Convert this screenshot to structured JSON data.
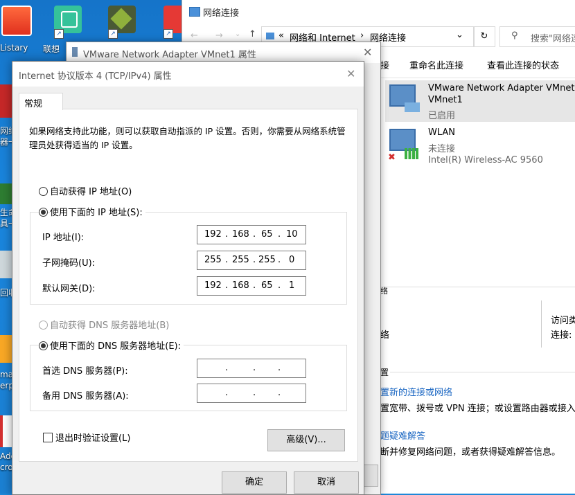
{
  "desktop": {
    "icons": [
      {
        "label": "Listary",
        "name": "listary"
      },
      {
        "label": "联想",
        "name": "lenovo-store"
      }
    ],
    "side_fragments": [
      "网络",
      "器一",
      "生命",
      "具一",
      "回收",
      "mar",
      "erp",
      "Ado",
      "cro"
    ]
  },
  "explorer": {
    "title": "网络连接",
    "breadcrumb": [
      "«",
      "网络和 Internet",
      "›",
      "网络连接"
    ],
    "search_placeholder": "搜索\"网络连",
    "toolbar": [
      "接",
      "重命名此连接",
      "查看此连接的状态"
    ],
    "connections": [
      {
        "name": "VMware Network Adapter VMnet1",
        "line2": "VMnet1",
        "status": "已启用",
        "device": ""
      },
      {
        "name": "WLAN",
        "line2": "",
        "status": "未连接",
        "device": "Intel(R) Wireless-AC 9560"
      }
    ],
    "lower": {
      "heading_frag": "络",
      "sub_frag": "络",
      "access_label": "访问类",
      "conn_label": "连接:",
      "section_frag": "置",
      "link1": "置新的连接或网络",
      "desc1": "置宽带、拨号或 VPN 连接；或设置路由器或接入",
      "link2": "题疑难解答",
      "desc2": "断并修复网络问题，或者获得疑难解答信息。"
    }
  },
  "vm_dialog": {
    "title": "VMware Network Adapter VMnet1 属性"
  },
  "ipv4_dialog": {
    "title": "Internet 协议版本 4 (TCP/IPv4) 属性",
    "tab": "常规",
    "description": "如果网络支持此功能，则可以获取自动指派的 IP 设置。否则，你需要从网络系统管理员处获得适当的 IP 设置。",
    "auto_ip": "自动获得 IP 地址(O)",
    "manual_ip": "使用下面的 IP 地址(S):",
    "ip_label": "IP 地址(I):",
    "ip_value": [
      "192",
      "168",
      "65",
      "10"
    ],
    "mask_label": "子网掩码(U):",
    "mask_value": [
      "255",
      "255",
      "255",
      "0"
    ],
    "gateway_label": "默认网关(D):",
    "gateway_value": [
      "192",
      "168",
      "65",
      "1"
    ],
    "auto_dns": "自动获得 DNS 服务器地址(B)",
    "manual_dns": "使用下面的 DNS 服务器地址(E):",
    "pref_dns_label": "首选 DNS 服务器(P):",
    "alt_dns_label": "备用 DNS 服务器(A):",
    "validate": "退出时验证设置(L)",
    "advanced": "高级(V)...",
    "ok": "确定",
    "cancel": "取消",
    "selected_ip_mode": "manual",
    "selected_dns_mode": "manual"
  }
}
